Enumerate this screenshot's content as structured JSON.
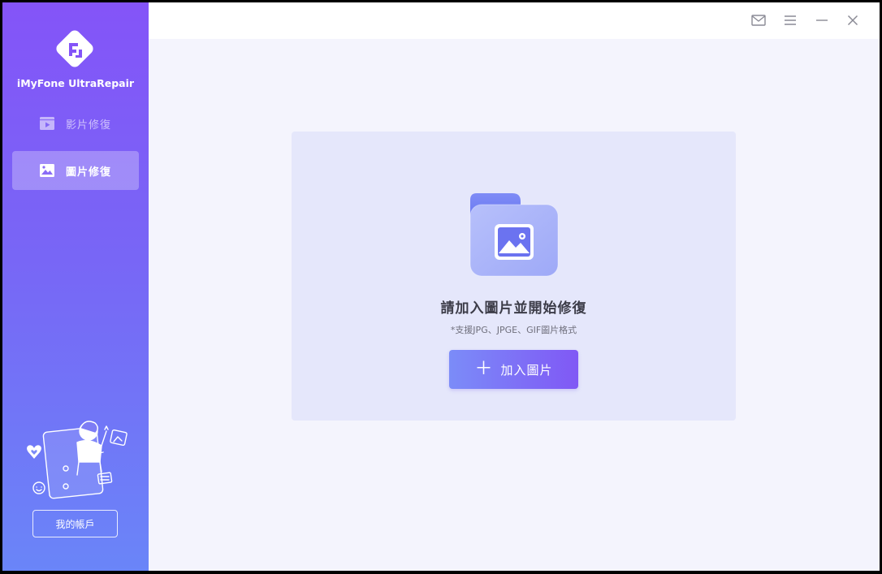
{
  "app": {
    "name": "iMyFone UltraRepair"
  },
  "sidebar": {
    "items": [
      {
        "label": "影片修復",
        "icon": "video-play-icon",
        "active": false
      },
      {
        "label": "圖片修復",
        "icon": "image-icon",
        "active": true
      }
    ],
    "account_label": "我的帳戶"
  },
  "titlebar": {
    "icons": [
      "mail-icon",
      "menu-icon",
      "minimize-icon",
      "close-icon"
    ]
  },
  "main": {
    "title": "請加入圖片並開始修復",
    "subtitle": "*支援JPG、JPGE、GIF圖片格式",
    "add_button_label": "加入圖片",
    "add_button_icon": "plus-icon"
  },
  "colors": {
    "sidebar_top": "#8454f8",
    "sidebar_bottom": "#6a85f8",
    "accent": "#7b6af6",
    "panel_bg": "#e5e7fb",
    "page_bg": "#f4f4fd"
  }
}
